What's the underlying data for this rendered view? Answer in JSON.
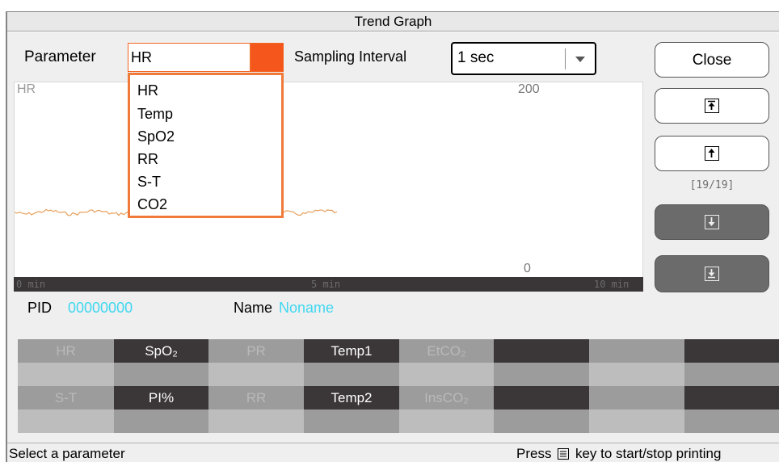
{
  "window": {
    "title": "Trend Graph"
  },
  "controls": {
    "parameter_label": "Parameter",
    "parameter_value": "HR",
    "parameter_options": [
      "HR",
      "Temp",
      "SpO2",
      "RR",
      "S-T",
      "CO2"
    ],
    "sampling_label": "Sampling Interval",
    "sampling_value": "1 sec"
  },
  "graph": {
    "param_label": "HR",
    "ymax": "200",
    "ymin": "0",
    "time_labels": [
      "0 min",
      "5 min",
      "10 min"
    ],
    "trace_color": "#e7a05c"
  },
  "side": {
    "close_label": "Close",
    "page_indicator": "[19/19]",
    "icons": [
      "page-first-icon",
      "page-up-icon",
      "page-down-icon",
      "page-last-icon"
    ]
  },
  "patient": {
    "pid_label": "PID",
    "pid_value": "00000000",
    "name_label": "Name",
    "name_value": "Noname",
    "value_color": "#3fd7f0"
  },
  "grid": {
    "row1": [
      "HR",
      "SpO₂",
      "PR",
      "Temp1",
      "EtCO₂"
    ],
    "row2": [
      "S-T",
      "PI%",
      "RR",
      "Temp2",
      "InsCO₂"
    ]
  },
  "status": {
    "left": "Select a parameter",
    "right_prefix": "Press",
    "right_suffix": "key to start/stop printing"
  }
}
